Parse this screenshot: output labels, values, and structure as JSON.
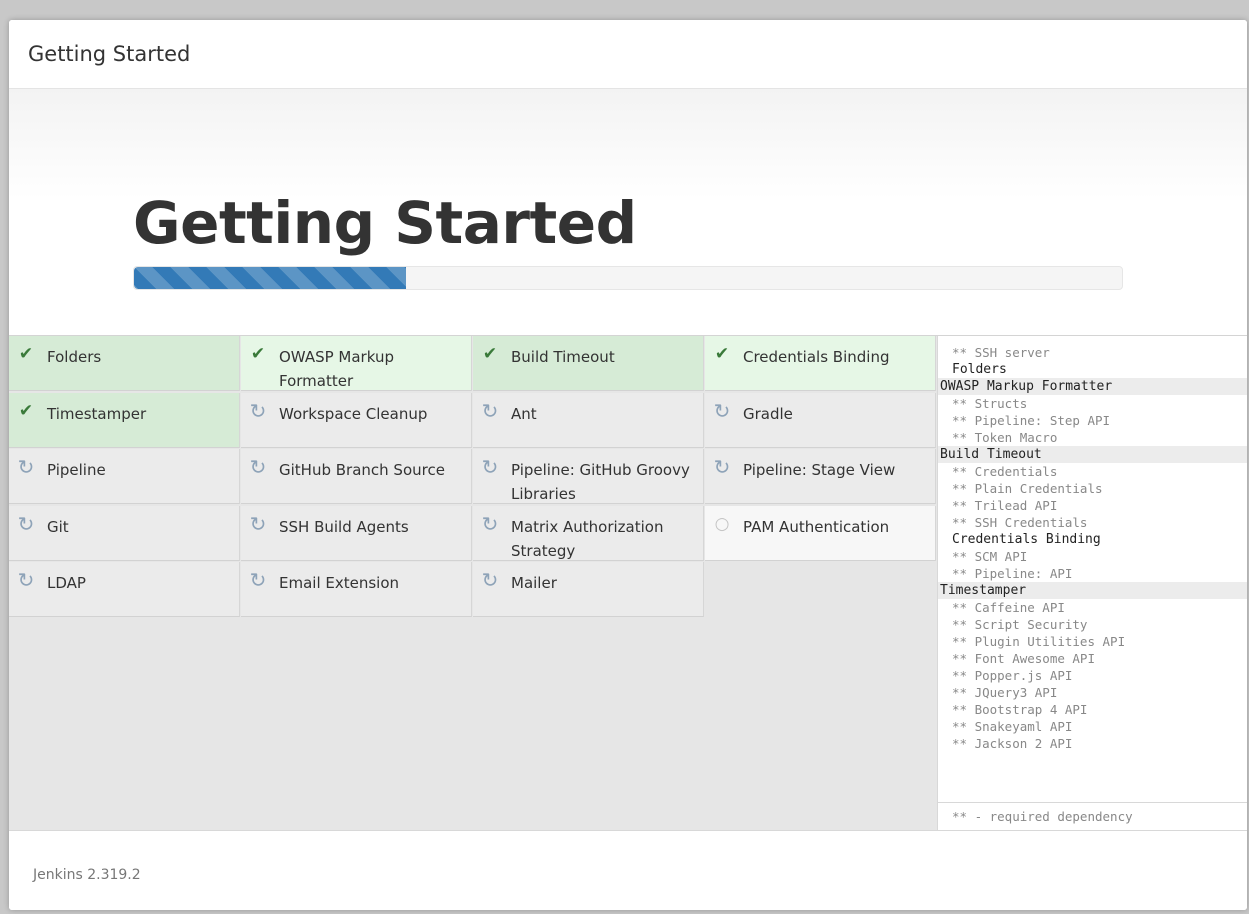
{
  "header": {
    "title": "Getting Started"
  },
  "hero": {
    "title": "Getting Started",
    "progress_fraction": 0.275,
    "accent_color": "#337ab7"
  },
  "plugins": [
    {
      "label": "Folders",
      "status": "success",
      "icon": "check-icon"
    },
    {
      "label": "OWASP Markup Formatter",
      "status": "success",
      "icon": "check-icon"
    },
    {
      "label": "Build Timeout",
      "status": "success",
      "icon": "check-icon"
    },
    {
      "label": "Credentials Binding",
      "status": "success",
      "icon": "check-icon"
    },
    {
      "label": "Timestamper",
      "status": "success",
      "icon": "check-icon"
    },
    {
      "label": "Workspace Cleanup",
      "status": "installing",
      "icon": "refresh-icon"
    },
    {
      "label": "Ant",
      "status": "installing",
      "icon": "refresh-icon"
    },
    {
      "label": "Gradle",
      "status": "installing",
      "icon": "refresh-icon"
    },
    {
      "label": "Pipeline",
      "status": "installing",
      "icon": "refresh-icon"
    },
    {
      "label": "GitHub Branch Source",
      "status": "installing",
      "icon": "refresh-icon"
    },
    {
      "label": "Pipeline: GitHub Groovy Libraries",
      "status": "installing",
      "icon": "refresh-icon"
    },
    {
      "label": "Pipeline: Stage View",
      "status": "installing",
      "icon": "refresh-icon"
    },
    {
      "label": "Git",
      "status": "installing",
      "icon": "refresh-icon"
    },
    {
      "label": "SSH Build Agents",
      "status": "installing",
      "icon": "refresh-icon"
    },
    {
      "label": "Matrix Authorization Strategy",
      "status": "installing",
      "icon": "refresh-icon"
    },
    {
      "label": "PAM Authentication",
      "status": "pending",
      "icon": "circle-icon"
    },
    {
      "label": "LDAP",
      "status": "installing",
      "icon": "refresh-icon"
    },
    {
      "label": "Email Extension",
      "status": "installing",
      "icon": "refresh-icon"
    },
    {
      "label": "Mailer",
      "status": "installing",
      "icon": "refresh-icon"
    }
  ],
  "log": {
    "lines": [
      {
        "text": "** SSH server",
        "kind": "dependency"
      },
      {
        "text": "Folders",
        "kind": "plugin"
      },
      {
        "text": "OWASP Markup Formatter",
        "kind": "plugin-shaded"
      },
      {
        "text": "** Structs",
        "kind": "dependency"
      },
      {
        "text": "** Pipeline: Step API",
        "kind": "dependency"
      },
      {
        "text": "** Token Macro",
        "kind": "dependency"
      },
      {
        "text": "Build Timeout",
        "kind": "plugin-shaded"
      },
      {
        "text": "** Credentials",
        "kind": "dependency"
      },
      {
        "text": "** Plain Credentials",
        "kind": "dependency"
      },
      {
        "text": "** Trilead API",
        "kind": "dependency"
      },
      {
        "text": "** SSH Credentials",
        "kind": "dependency"
      },
      {
        "text": "Credentials Binding",
        "kind": "plugin"
      },
      {
        "text": "** SCM API",
        "kind": "dependency"
      },
      {
        "text": "** Pipeline: API",
        "kind": "dependency"
      },
      {
        "text": "Timestamper",
        "kind": "plugin-shaded"
      },
      {
        "text": "** Caffeine API",
        "kind": "dependency"
      },
      {
        "text": "** Script Security",
        "kind": "dependency"
      },
      {
        "text": "** Plugin Utilities API",
        "kind": "dependency"
      },
      {
        "text": "** Font Awesome API",
        "kind": "dependency"
      },
      {
        "text": "** Popper.js API",
        "kind": "dependency"
      },
      {
        "text": "** JQuery3 API",
        "kind": "dependency"
      },
      {
        "text": "** Bootstrap 4 API",
        "kind": "dependency"
      },
      {
        "text": "** Snakeyaml API",
        "kind": "dependency"
      },
      {
        "text": "** Jackson 2 API",
        "kind": "dependency"
      }
    ],
    "legend": "** - required dependency"
  },
  "footer": {
    "version": "Jenkins 2.319.2"
  }
}
